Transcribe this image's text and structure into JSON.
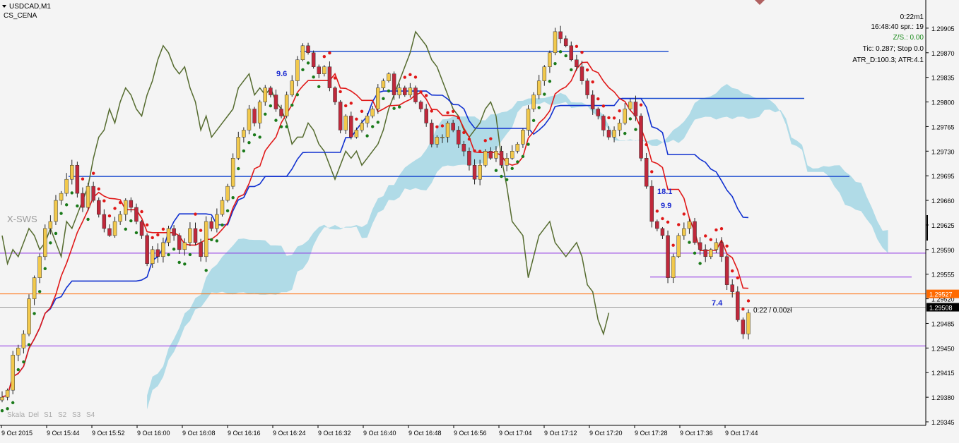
{
  "symbol_header": {
    "symbol": "USDCAD,M1",
    "indicator": "CS_CENA"
  },
  "info_panel": {
    "time_left": "0:22m1",
    "server_time": "16:48:40 spr.: 19",
    "zs": "Z/S.: 0.00",
    "tic": "Tic: 0.287; Stop 0.0",
    "atr": "ATR_D:100.3; ATR:4.1"
  },
  "watermark": "X-SWS",
  "bottom_labels": [
    "Skala",
    "Del",
    "S1",
    "S2",
    "S3",
    "S4"
  ],
  "annotations": {
    "a1": "9.6",
    "a2": "18.1",
    "a3": "9.9",
    "a4": "7.4",
    "profit": "0:22 / 0.00zł"
  },
  "colors": {
    "background": "#f4f4f4",
    "bull_candle": "#f2c94c",
    "bear_candle": "#c0283b",
    "tenkan": "#e01818",
    "kijun": "#1030d0",
    "kumo_bear": "#a8d8e6",
    "kumo_bull": "#90e890",
    "chikou": "#556b2f",
    "psar_up": "#1a7a1a",
    "psar_down": "#e01818",
    "hline_blue": "#2050d0",
    "hline_purple": "#8a2be2",
    "hline_orange": "#ff6a00",
    "price_box": "#ff6a00"
  },
  "chart_data": {
    "type": "candlestick",
    "symbol": "USDCAD",
    "timeframe": "M1",
    "ylim": [
      1.29345,
      1.29935
    ],
    "y_ticks": [
      "1.29905",
      "1.29870",
      "1.29835",
      "1.29800",
      "1.29765",
      "1.29730",
      "1.29695",
      "1.29660",
      "1.29625",
      "1.29590",
      "1.29555",
      "1.29520",
      "1.29485",
      "1.29450",
      "1.29415",
      "1.29380",
      "1.29345"
    ],
    "x_ticks": [
      "9 Oct 2015",
      "9 Oct 15:44",
      "9 Oct 15:52",
      "9 Oct 16:00",
      "9 Oct 16:08",
      "9 Oct 16:16",
      "9 Oct 16:24",
      "9 Oct 16:32",
      "9 Oct 16:40",
      "9 Oct 16:48",
      "9 Oct 16:56",
      "9 Oct 17:04",
      "9 Oct 17:12",
      "9 Oct 17:20",
      "9 Oct 17:28",
      "9 Oct 17:36",
      "9 Oct 17:44"
    ],
    "price_labels": {
      "upper": "1.29527",
      "current": "1.29508"
    },
    "horizontal_levels": {
      "blue": [
        1.29872,
        1.29805,
        1.29694
      ],
      "purple": [
        1.29585,
        1.29551,
        1.29453
      ],
      "orange": 1.29527,
      "current": 1.29508
    },
    "closes": [
      1.2938,
      1.2939,
      1.2944,
      1.2945,
      1.2947,
      1.2952,
      1.2955,
      1.2958,
      1.2962,
      1.2963,
      1.2966,
      1.2967,
      1.2969,
      1.2971,
      1.2967,
      1.2965,
      1.2968,
      1.2966,
      1.2964,
      1.2962,
      1.2961,
      1.2963,
      1.2964,
      1.2966,
      1.2965,
      1.2963,
      1.2961,
      1.2957,
      1.2959,
      1.2958,
      1.296,
      1.2962,
      1.2961,
      1.2959,
      1.296,
      1.2962,
      1.296,
      1.2958,
      1.2963,
      1.2962,
      1.2964,
      1.2966,
      1.2968,
      1.2972,
      1.2975,
      1.2976,
      1.2979,
      1.2977,
      1.298,
      1.2982,
      1.2981,
      1.2979,
      1.2978,
      1.2981,
      1.2983,
      1.2986,
      1.2988,
      1.2987,
      1.2985,
      1.2984,
      1.2985,
      1.2982,
      1.298,
      1.2976,
      1.2978,
      1.2975,
      1.2976,
      1.2977,
      1.2978,
      1.2979,
      1.2982,
      1.2983,
      1.2984,
      1.2981,
      1.2982,
      1.2981,
      1.2982,
      1.298,
      1.2979,
      1.2977,
      1.2974,
      1.2975,
      1.2975,
      1.2977,
      1.2976,
      1.2974,
      1.2973,
      1.2971,
      1.2969,
      1.2971,
      1.2973,
      1.2972,
      1.2973,
      1.2971,
      1.2972,
      1.2973,
      1.2974,
      1.2976,
      1.2979,
      1.2981,
      1.2983,
      1.2985,
      1.2987,
      1.299,
      1.2989,
      1.2988,
      1.2986,
      1.2985,
      1.2983,
      1.2981,
      1.2979,
      1.2978,
      1.2976,
      1.2975,
      1.2976,
      1.2977,
      1.2979,
      1.298,
      1.2978,
      1.2972,
      1.2968,
      1.2963,
      1.2962,
      1.2961,
      1.2955,
      1.2958,
      1.2961,
      1.2962,
      1.2963,
      1.296,
      1.2959,
      1.2958,
      1.2959,
      1.296,
      1.2958,
      1.2954,
      1.2953,
      1.2949,
      1.2947,
      1.295
    ]
  }
}
